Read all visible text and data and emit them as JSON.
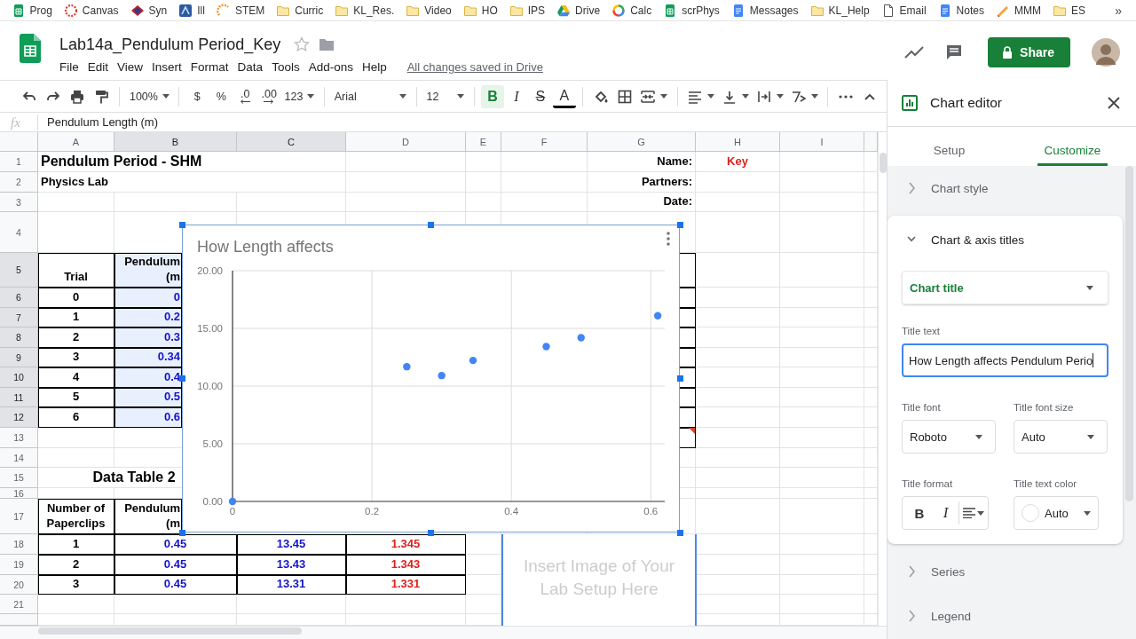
{
  "bookmarks": [
    {
      "label": "Prog",
      "kind": "sheet"
    },
    {
      "label": "Canvas",
      "kind": "canvas"
    },
    {
      "label": "Syn",
      "kind": "diamond"
    },
    {
      "label": "Ill",
      "kind": "tile"
    },
    {
      "label": "STEM",
      "kind": "arc"
    },
    {
      "label": "Curric",
      "kind": "folder"
    },
    {
      "label": "KL_Res.",
      "kind": "folder"
    },
    {
      "label": "Video",
      "kind": "folder"
    },
    {
      "label": "HO",
      "kind": "folder"
    },
    {
      "label": "IPS",
      "kind": "folder"
    },
    {
      "label": "Drive",
      "kind": "drive"
    },
    {
      "label": "Calc",
      "kind": "ring"
    },
    {
      "label": "scrPhys",
      "kind": "sheet"
    },
    {
      "label": "Messages",
      "kind": "doc"
    },
    {
      "label": "KL_Help",
      "kind": "folder"
    },
    {
      "label": "Email",
      "kind": "page"
    },
    {
      "label": "Notes",
      "kind": "doc"
    },
    {
      "label": "MMM",
      "kind": "pencil"
    },
    {
      "label": "ES",
      "kind": "folder"
    }
  ],
  "bookmarks_more": "»",
  "document": {
    "title": "Lab14a_Pendulum Period_Key",
    "starred": false,
    "menu": [
      "File",
      "Edit",
      "View",
      "Insert",
      "Format",
      "Data",
      "Tools",
      "Add-ons",
      "Help"
    ],
    "save_status": "All changes saved in Drive"
  },
  "share_button": "Share",
  "toolbar": {
    "zoom": "100%",
    "number_formats": [
      {
        "label": "$",
        "kind": "currency"
      },
      {
        "label": "%",
        "kind": "percent"
      },
      {
        "label": ".0",
        "kind": "decrease"
      },
      {
        "label": ".00",
        "kind": "increase"
      }
    ],
    "more_formats": "123",
    "font": "Arial",
    "font_size": "12",
    "text_formats": [
      {
        "label": "B",
        "kind": "bold",
        "selected": true
      },
      {
        "label": "I",
        "kind": "italic",
        "selected": false
      },
      {
        "label": "S",
        "kind": "strike",
        "selected": false
      },
      {
        "label": "A",
        "kind": "color",
        "selected": false
      }
    ]
  },
  "formula_bar": {
    "icon_text": "fx",
    "value": "Pendulum Length (m)"
  },
  "sheet": {
    "columns": [
      {
        "label": "A",
        "selected": false
      },
      {
        "label": "B",
        "selected": true
      },
      {
        "label": "C",
        "selected": true
      },
      {
        "label": "D",
        "selected": false
      },
      {
        "label": "E",
        "selected": false
      },
      {
        "label": "F",
        "selected": false
      },
      {
        "label": "G",
        "selected": false
      },
      {
        "label": "H",
        "selected": false
      },
      {
        "label": "I",
        "selected": false
      }
    ],
    "rows": [
      {
        "label": "1",
        "selected": false,
        "cells": [
          {
            "text": "Pendulum Period - SHM",
            "kind": "title",
            "boxed": false,
            "selected": false
          },
          null,
          null,
          null,
          null,
          null,
          {
            "text": "Name:",
            "kind": "label",
            "boxed": false,
            "selected": false
          },
          {
            "text": "Key",
            "kind": "key",
            "boxed": false,
            "selected": false
          },
          null
        ]
      },
      {
        "label": "2",
        "selected": false,
        "cells": [
          {
            "text": "Physics Lab",
            "kind": "text",
            "boxed": false,
            "selected": false
          },
          null,
          null,
          null,
          null,
          null,
          {
            "text": "Partners:",
            "kind": "label",
            "boxed": false,
            "selected": false
          },
          null,
          null
        ]
      },
      {
        "label": "3",
        "selected": false,
        "cells": [
          null,
          null,
          null,
          null,
          null,
          null,
          {
            "text": "Date:",
            "kind": "label",
            "boxed": false,
            "selected": false
          },
          null,
          null
        ]
      },
      {
        "label": "4",
        "selected": false
      },
      {
        "label": "5",
        "selected": true,
        "cells": [
          {
            "text": "Trial",
            "kind": "head",
            "boxed": true,
            "selected": false
          },
          {
            "text": "Pendulum\n(m",
            "kind": "headcut",
            "boxed": true,
            "selected": true
          },
          null,
          null,
          null,
          null,
          {
            "boxed": true,
            "selected": false
          },
          null,
          null
        ]
      },
      {
        "label": "6",
        "selected": true,
        "cells": [
          {
            "text": "0",
            "kind": "num",
            "boxed": true,
            "selected": false
          },
          {
            "text": "0",
            "kind": "bluecut",
            "boxed": true,
            "selected": true
          },
          null,
          null,
          null,
          null,
          {
            "boxed": true,
            "selected": false
          },
          null,
          null
        ]
      },
      {
        "label": "7",
        "selected": true,
        "cells": [
          {
            "text": "1",
            "kind": "num",
            "boxed": true,
            "selected": false
          },
          {
            "text": "0.2",
            "kind": "bluecut",
            "boxed": true,
            "selected": true
          },
          null,
          null,
          null,
          null,
          {
            "boxed": true,
            "selected": false
          },
          null,
          null
        ]
      },
      {
        "label": "8",
        "selected": true,
        "cells": [
          {
            "text": "2",
            "kind": "num",
            "boxed": true,
            "selected": false
          },
          {
            "text": "0.3",
            "kind": "bluecut",
            "boxed": true,
            "selected": true
          },
          null,
          null,
          null,
          null,
          {
            "boxed": true,
            "selected": false
          },
          null,
          null
        ]
      },
      {
        "label": "9",
        "selected": true,
        "cells": [
          {
            "text": "3",
            "kind": "num",
            "boxed": true,
            "selected": false
          },
          {
            "text": "0.34",
            "kind": "bluecut",
            "boxed": true,
            "selected": true
          },
          null,
          null,
          null,
          null,
          {
            "boxed": true,
            "selected": false
          },
          null,
          null
        ]
      },
      {
        "label": "10",
        "selected": true,
        "cells": [
          {
            "text": "4",
            "kind": "num",
            "boxed": true,
            "selected": false
          },
          {
            "text": "0.4",
            "kind": "bluecut",
            "boxed": true,
            "selected": true
          },
          null,
          null,
          null,
          null,
          {
            "boxed": true,
            "selected": false
          },
          null,
          null
        ]
      },
      {
        "label": "11",
        "selected": true,
        "cells": [
          {
            "text": "5",
            "kind": "num",
            "boxed": true,
            "selected": false
          },
          {
            "text": "0.5",
            "kind": "bluecut",
            "boxed": true,
            "selected": true
          },
          null,
          null,
          null,
          null,
          {
            "boxed": true,
            "selected": false
          },
          null,
          null
        ]
      },
      {
        "label": "12",
        "selected": true,
        "cells": [
          {
            "text": "6",
            "kind": "num",
            "boxed": true,
            "selected": false
          },
          {
            "text": "0.6",
            "kind": "bluecut",
            "boxed": true,
            "selected": true
          },
          null,
          null,
          null,
          null,
          {
            "boxed": true,
            "selected": false
          },
          null,
          null
        ]
      },
      {
        "label": "13",
        "selected": false,
        "cells": [
          null,
          null,
          null,
          null,
          null,
          null,
          {
            "boxed": true,
            "selected": false,
            "comment": true
          },
          null,
          null
        ]
      },
      {
        "label": "14",
        "selected": false
      },
      {
        "label": "15",
        "selected": false,
        "cells": [
          {
            "text": "Data Table 2",
            "kind": "caption",
            "boxed": false,
            "selected": false
          },
          null,
          null,
          null,
          null,
          null,
          null,
          null,
          null
        ]
      },
      {
        "label": "16",
        "selected": false
      },
      {
        "label": "17",
        "selected": false,
        "cells": [
          {
            "text": "Number of\nPaperclips",
            "kind": "head",
            "boxed": true,
            "selected": false
          },
          {
            "text": "Pendulum\n(m",
            "kind": "headcut",
            "boxed": true,
            "selected": false
          },
          null,
          null,
          null,
          null,
          null,
          null,
          null
        ]
      },
      {
        "label": "18",
        "selected": false,
        "cells": [
          {
            "text": "1",
            "kind": "num",
            "boxed": true,
            "selected": false
          },
          {
            "text": "0.45",
            "kind": "blue",
            "boxed": true,
            "selected": false
          },
          {
            "text": "13.45",
            "kind": "blue",
            "boxed": true,
            "selected": false
          },
          {
            "text": "1.345",
            "kind": "red",
            "boxed": true,
            "selected": false
          },
          null,
          null,
          null,
          null,
          null
        ]
      },
      {
        "label": "19",
        "selected": false,
        "cells": [
          {
            "text": "2",
            "kind": "num",
            "boxed": true,
            "selected": false
          },
          {
            "text": "0.45",
            "kind": "blue",
            "boxed": true,
            "selected": false
          },
          {
            "text": "13.43",
            "kind": "blue",
            "boxed": true,
            "selected": false
          },
          {
            "text": "1.343",
            "kind": "red",
            "boxed": true,
            "selected": false
          },
          null,
          null,
          null,
          null,
          null
        ]
      },
      {
        "label": "20",
        "selected": false,
        "cells": [
          {
            "text": "3",
            "kind": "num",
            "boxed": true,
            "selected": false
          },
          {
            "text": "0.45",
            "kind": "blue",
            "boxed": true,
            "selected": false
          },
          {
            "text": "13.31",
            "kind": "blue",
            "boxed": true,
            "selected": false
          },
          {
            "text": "1.331",
            "kind": "red",
            "boxed": true,
            "selected": false
          },
          null,
          null,
          null,
          null,
          null
        ]
      },
      {
        "label": "21",
        "selected": false
      }
    ],
    "chart": {
      "chart_data": {
        "type": "scatter",
        "title": "How Length affects",
        "x": [
          0,
          0.25,
          0.3,
          0.345,
          0.45,
          0.5,
          0.61
        ],
        "series": [
          {
            "color": "#4285f4",
            "values": [
              0,
              11.68,
              10.91,
              12.22,
              13.42,
              14.19,
              16.1
            ]
          }
        ],
        "xlim": [
          0,
          0.62
        ],
        "ylim": [
          0,
          20
        ],
        "grid": true,
        "xticks": [
          {
            "value": 0,
            "label": "0"
          },
          {
            "value": 0.2,
            "label": "0.2"
          },
          {
            "value": 0.4,
            "label": "0.4"
          },
          {
            "value": 0.6,
            "label": "0.6"
          }
        ],
        "yticks": [
          {
            "value": 0,
            "label": "0.00"
          },
          {
            "value": 5,
            "label": "5.00"
          },
          {
            "value": 10,
            "label": "10.00"
          },
          {
            "value": 15,
            "label": "15.00"
          },
          {
            "value": 20,
            "label": "20.00"
          }
        ]
      }
    },
    "image_placeholder": "Insert Image of Your Lab Setup Here"
  },
  "chart_editor": {
    "title": "Chart editor",
    "tabs": [
      {
        "label": "Setup",
        "selected": false
      },
      {
        "label": "Customize",
        "selected": true
      }
    ],
    "sections": [
      {
        "title": "Chart style",
        "expanded": false
      },
      {
        "title": "Chart & axis titles",
        "expanded": true,
        "fields": {
          "target": "Chart title",
          "title_text": {
            "label": "Title text",
            "value": "How Length affects Pendulum Perio",
            "focused": true
          },
          "title_font": {
            "label": "Title font",
            "value": "Roboto"
          },
          "title_font_size": {
            "label": "Title font size",
            "value": "Auto"
          },
          "title_format": {
            "label": "Title format",
            "bold": "B",
            "italic": "I"
          },
          "title_text_color": {
            "label": "Title text color",
            "value": "Auto"
          }
        }
      },
      {
        "title": "Series",
        "expanded": false
      },
      {
        "title": "Legend",
        "expanded": false
      }
    ]
  }
}
